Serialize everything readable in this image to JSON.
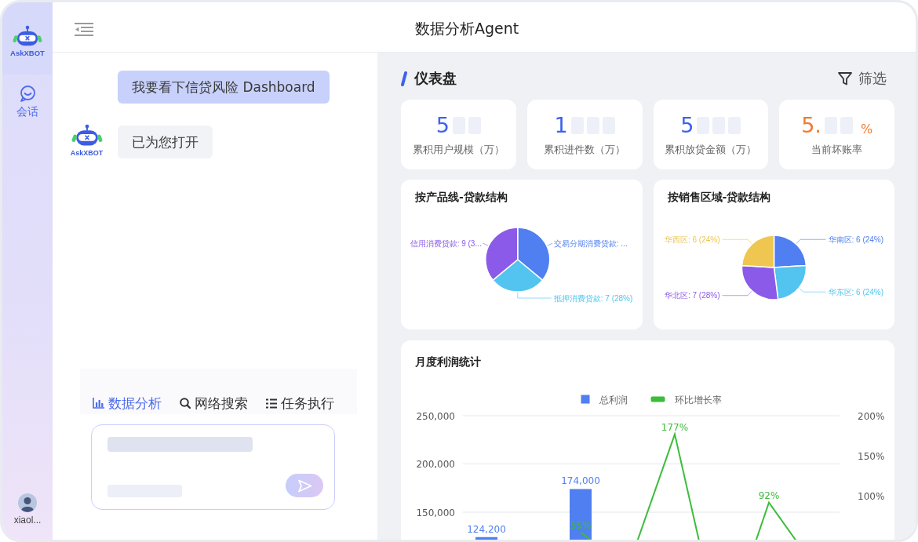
{
  "header": {
    "title": "数据分析Agent"
  },
  "sidebar": {
    "logo_text": "AskXBOT",
    "items": [
      {
        "label": "会话",
        "selected": true
      }
    ],
    "user": {
      "name": "xiaol..."
    }
  },
  "chat": {
    "messages": [
      {
        "kind": "user",
        "text": "我要看下信贷风险 Dashboard"
      },
      {
        "kind": "bot",
        "sender": "AskXBOT",
        "text": "已为您打开"
      }
    ],
    "tools": [
      {
        "label": "数据分析",
        "selected": true
      },
      {
        "label": "网络搜索",
        "selected": false
      },
      {
        "label": "任务执行",
        "selected": false
      }
    ]
  },
  "dashboard": {
    "title": "仪表盘",
    "filter_label": "筛选",
    "kpis": [
      {
        "color": "#3d63ee",
        "value_parts": [
          {
            "kind": "digit",
            "text": "5"
          },
          {
            "kind": "mask"
          },
          {
            "kind": "mask"
          }
        ],
        "label": "累积用户规模（万）"
      },
      {
        "color": "#3d63ee",
        "value_parts": [
          {
            "kind": "digit",
            "text": "1"
          },
          {
            "kind": "mask"
          },
          {
            "kind": "mask"
          },
          {
            "kind": "mask"
          }
        ],
        "label": "累积进件数（万）"
      },
      {
        "color": "#3d63ee",
        "value_parts": [
          {
            "kind": "digit",
            "text": "5"
          },
          {
            "kind": "mask"
          },
          {
            "kind": "mask"
          },
          {
            "kind": "mask"
          }
        ],
        "label": "累积放贷金额（万）"
      },
      {
        "color": "#f27a2e",
        "value_parts": [
          {
            "kind": "digit",
            "text": "5."
          },
          {
            "kind": "mask"
          },
          {
            "kind": "mask"
          },
          {
            "kind": "unit",
            "text": "%"
          }
        ],
        "label": "当前坏账率"
      }
    ],
    "pie_cards": [
      {
        "chart_data": {
          "type": "pie",
          "title": "按产品线-贷款结构",
          "categories": [
            "交易分期消费贷款: ...",
            "抵押消费贷款: 7 (28%)",
            "信用消费贷款: 9 (3..."
          ],
          "values": [
            9,
            7,
            9
          ],
          "colors": [
            "#4f7ff0",
            "#52c4ef",
            "#8c5ae8"
          ]
        }
      },
      {
        "chart_data": {
          "type": "pie",
          "title": "按销售区域-贷款结构",
          "categories": [
            "华南区: 6 (24%)",
            "华东区: 6 (24%)",
            "华北区: 7 (28%)",
            "华西区: 6 (24%)"
          ],
          "values": [
            6,
            6,
            7,
            6
          ],
          "colors": [
            "#4f7ff0",
            "#52c4ef",
            "#8c5ae8",
            "#efc64f"
          ]
        }
      }
    ],
    "profit_card": {
      "chart_data": {
        "type": "bar",
        "title": "月度利润统计",
        "legend": "top",
        "series": [
          {
            "name": "总利润",
            "color": "#4f7ff0",
            "values": [
              124200,
              null,
              174000,
              null,
              null,
              null,
              null,
              null
            ]
          },
          {
            "name": "环比增长率",
            "type": "line",
            "axis": "y2",
            "color": "#3bbd3b",
            "values": [
              null,
              null,
              55,
              10,
              177,
              -80,
              92,
              10
            ]
          }
        ],
        "ylim": [
          0,
          250000
        ],
        "yticks": [
          {
            "value": 150000,
            "label": "150,000"
          },
          {
            "value": 200000,
            "label": "200,000"
          },
          {
            "value": 250000,
            "label": "250,000"
          }
        ],
        "y2lim": [
          -100,
          200
        ],
        "y2ticks": [
          {
            "value": 100,
            "label": "100%"
          },
          {
            "value": 150,
            "label": "150%"
          },
          {
            "value": 200,
            "label": "200%"
          }
        ],
        "value_labels": [
          [
            "124,200",
            null,
            "174,000",
            null,
            null,
            null,
            null,
            null
          ],
          [
            null,
            null,
            "55%",
            null,
            "177%",
            null,
            "92%",
            null
          ]
        ]
      }
    }
  }
}
